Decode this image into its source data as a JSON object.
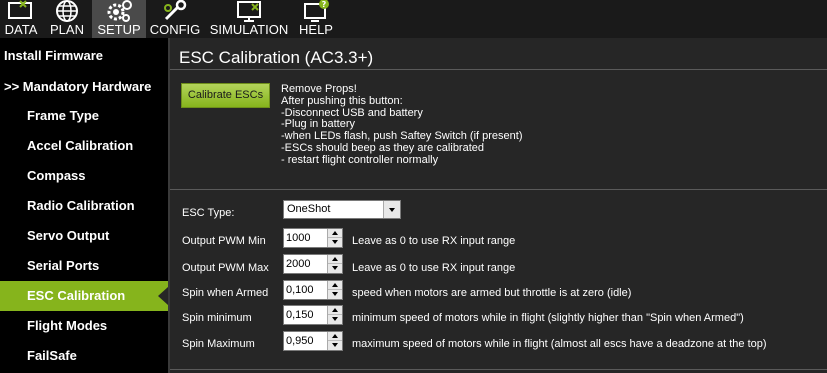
{
  "toolbar": {
    "items": [
      {
        "label": "DATA",
        "icon": "data-screen-icon"
      },
      {
        "label": "PLAN",
        "icon": "globe-icon"
      },
      {
        "label": "SETUP",
        "icon": "gears-icon"
      },
      {
        "label": "CONFIG",
        "icon": "wrench-icon"
      },
      {
        "label": "SIMULATION",
        "icon": "monitor-icon"
      },
      {
        "label": "HELP",
        "icon": "help-monitor-icon"
      }
    ],
    "active": "SETUP"
  },
  "sidebar": {
    "items": [
      {
        "label": "Install Firmware"
      },
      {
        "label": ">> Mandatory Hardware"
      },
      {
        "label": "Frame Type"
      },
      {
        "label": "Accel Calibration"
      },
      {
        "label": "Compass"
      },
      {
        "label": "Radio Calibration"
      },
      {
        "label": "Servo Output"
      },
      {
        "label": "Serial Ports"
      },
      {
        "label": "ESC Calibration"
      },
      {
        "label": "Flight Modes"
      },
      {
        "label": "FailSafe"
      }
    ],
    "active": "ESC Calibration"
  },
  "main": {
    "title": "ESC Calibration (AC3.3+)",
    "calibrate_button": "Calibrate ESCs",
    "instructions": [
      "Remove Props!",
      "After pushing this button:",
      "-Disconnect USB and battery",
      "-Plug in battery",
      "-when LEDs flash, push Saftey Switch (if present)",
      "-ESCs should beep as they are calibrated",
      "- restart flight controller normally"
    ],
    "esc_type": {
      "label": "ESC Type:",
      "value": "OneShot"
    },
    "params": [
      {
        "label": "Output PWM Min",
        "value": "1000",
        "desc": "Leave as 0 to use RX input range"
      },
      {
        "label": "Output PWM Max",
        "value": "2000",
        "desc": "Leave as 0 to use RX input range"
      },
      {
        "label": "Spin when Armed",
        "value": "0,100",
        "desc": "speed when motors are armed but throttle is at zero (idle)"
      },
      {
        "label": "Spin minimum",
        "value": "0,150",
        "desc": "minimum speed of motors while in flight (slightly higher than \"Spin when Armed\")"
      },
      {
        "label": "Spin Maximum",
        "value": "0,950",
        "desc": "maximum speed of motors while in flight (almost all escs have a deadzone at the top)"
      }
    ]
  },
  "colors": {
    "accent": "#86b41c",
    "background": "#262626",
    "sidebar": "#000000"
  }
}
